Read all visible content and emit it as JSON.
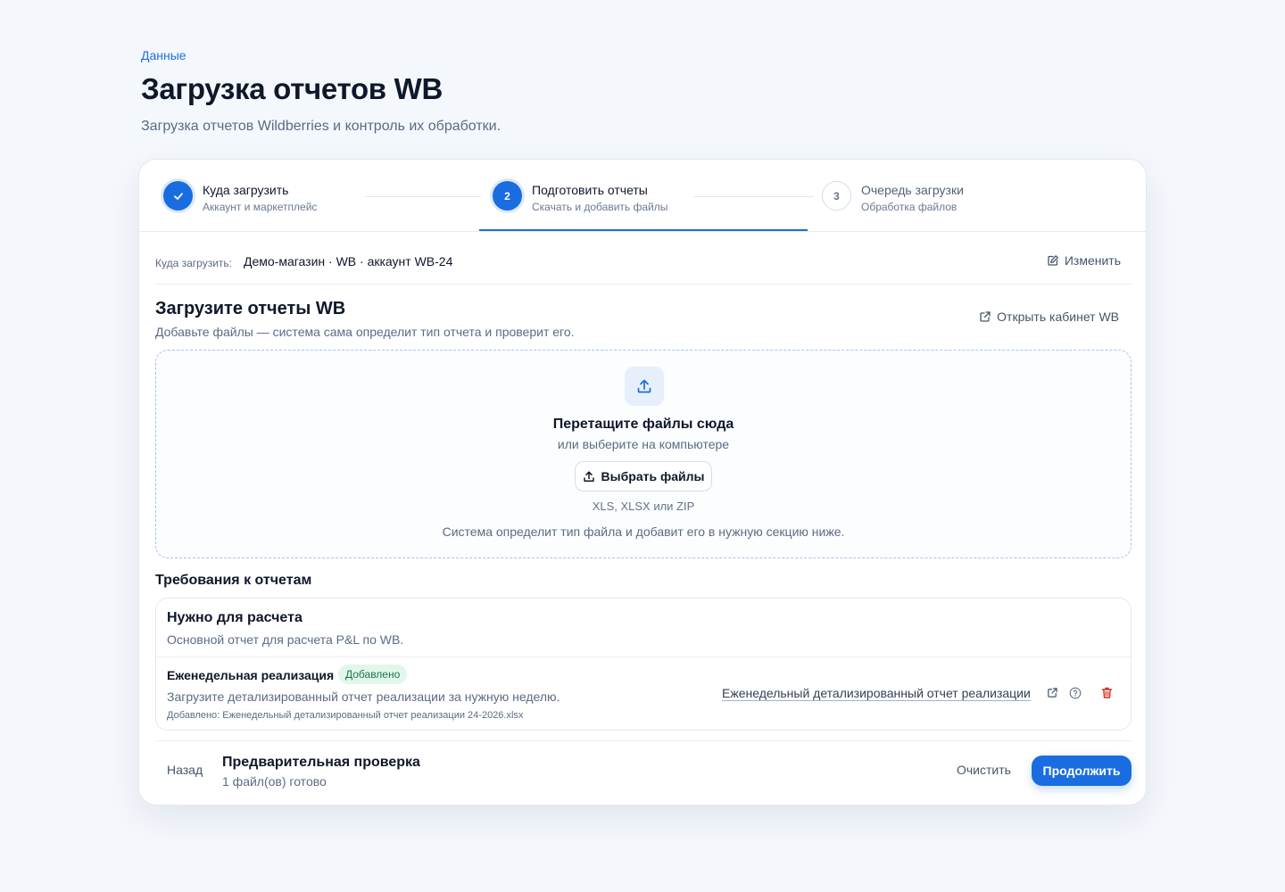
{
  "breadcrumb": "Данные",
  "page": {
    "title": "Загрузка отчетов WB",
    "subtitle": "Загрузка отчетов Wildberries и контроль их обработки."
  },
  "stepper": {
    "steps": [
      {
        "number": "",
        "title": "Куда загрузить",
        "subtitle": "Аккаунт и маркетплейс",
        "state": "done"
      },
      {
        "number": "2",
        "title": "Подготовить отчеты",
        "subtitle": "Скачать и добавить файлы",
        "state": "active"
      },
      {
        "number": "3",
        "title": "Очередь загрузки",
        "subtitle": "Обработка файлов",
        "state": "pending"
      }
    ]
  },
  "target": {
    "label": "Куда загрузить:",
    "value": "Демо-магазин · WB · аккаунт WB-24",
    "edit_label": "Изменить"
  },
  "upload": {
    "title": "Загрузите отчеты WB",
    "subtitle": "Добавьте файлы — система сама определит тип отчета и проверит его.",
    "open_cabinet_label": "Открыть кабинет WB",
    "dropzone": {
      "title": "Перетащите файлы сюда",
      "subtitle": "или выберите на компьютере",
      "button_label": "Выбрать файлы",
      "formats": "XLS, XLSX или ZIP",
      "note": "Система определит тип файла и добавит его в нужную секцию ниже."
    }
  },
  "requirements": {
    "title": "Требования к отчетам",
    "group": {
      "title": "Нужно для расчета",
      "subtitle": "Основной отчет для расчета P&L по WB.",
      "item": {
        "title": "Еженедельная реализация",
        "badge": "Добавлено",
        "subtitle": "Загрузите детализированный отчет реализации за нужную неделю.",
        "file": "Добавлено: Еженедельный детализированный отчет реализации 24-2026.xlsx",
        "link_label": "Еженедельный детализированный отчет реализации"
      }
    }
  },
  "footer": {
    "back_label": "Назад",
    "title": "Предварительная проверка",
    "subtitle": "1 файл(ов) готово",
    "clear_label": "Очистить",
    "continue_label": "Продолжить"
  },
  "colors": {
    "accent": "#1a6de0",
    "success_bg": "#e3f6ec",
    "success_text": "#16794a",
    "danger": "#d92d20",
    "background": "#f4f7fc"
  }
}
